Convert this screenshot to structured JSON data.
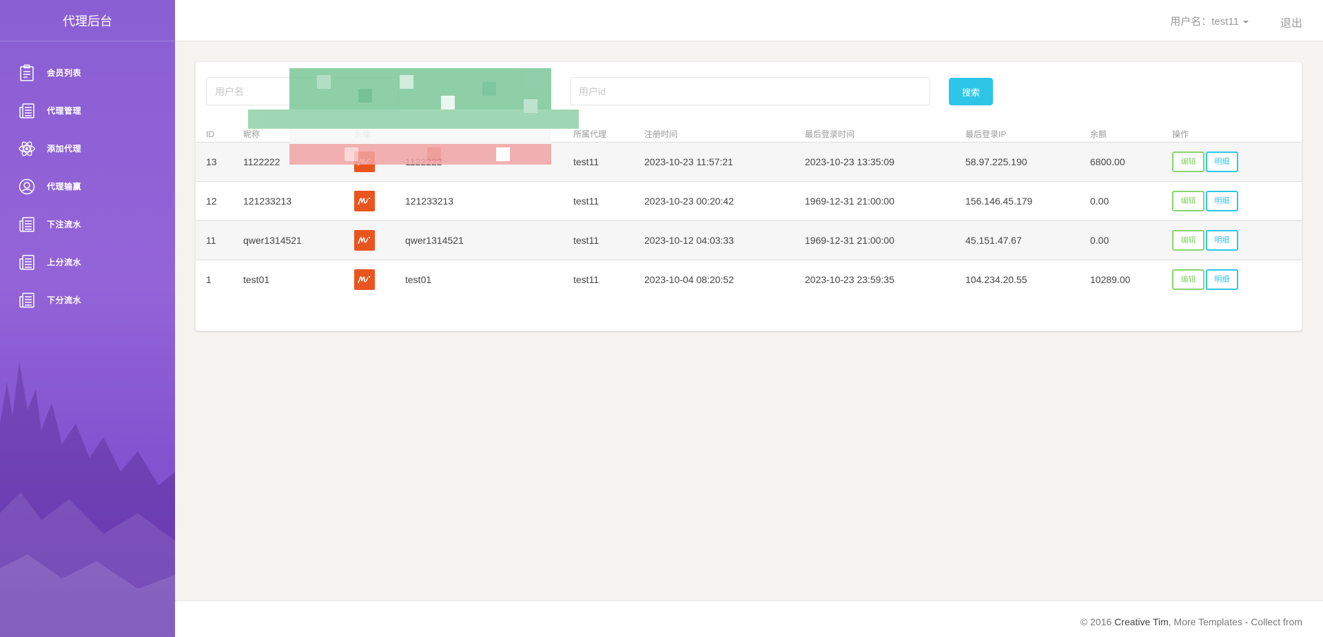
{
  "sidebar": {
    "title": "代理后台",
    "items": [
      {
        "label": "会员列表",
        "icon": "clipboard-icon"
      },
      {
        "label": "代理管理",
        "icon": "news-icon"
      },
      {
        "label": "添加代理",
        "icon": "atom-icon"
      },
      {
        "label": "代理输赢",
        "icon": "user-circle-icon"
      },
      {
        "label": "下注流水",
        "icon": "news-icon"
      },
      {
        "label": "上分流水",
        "icon": "news-icon"
      },
      {
        "label": "下分流水",
        "icon": "news-icon"
      }
    ]
  },
  "topbar": {
    "user_label": "用户名：test11",
    "logout_label": "退出"
  },
  "search": {
    "username_placeholder": "用户名",
    "userid_placeholder": "用户id",
    "button_label": "搜索"
  },
  "table": {
    "headers": [
      "ID",
      "昵称",
      "头像",
      "",
      "所属代理",
      "注册时间",
      "最后登录时间",
      "最后登录IP",
      "余额",
      "操作"
    ],
    "rows": [
      {
        "id": "13",
        "nickname": "1122222",
        "username": "1122222",
        "agent": "test11",
        "registered": "2023-10-23 11:57:21",
        "last_login": "2023-10-23 13:35:09",
        "last_ip": "58.97.225.190",
        "balance": "6800.00"
      },
      {
        "id": "12",
        "nickname": "121233213",
        "username": "121233213",
        "agent": "test11",
        "registered": "2023-10-23 00:20:42",
        "last_login": "1969-12-31 21:00:00",
        "last_ip": "156.146.45.179",
        "balance": "0.00"
      },
      {
        "id": "11",
        "nickname": "qwer1314521",
        "username": "qwer1314521",
        "agent": "test11",
        "registered": "2023-10-12 04:03:33",
        "last_login": "1969-12-31 21:00:00",
        "last_ip": "45.151.47.67",
        "balance": "0.00"
      },
      {
        "id": "1",
        "nickname": "test01",
        "username": "test01",
        "agent": "test11",
        "registered": "2023-10-04 08:20:52",
        "last_login": "2023-10-23 23:59:35",
        "last_ip": "104.234.20.55",
        "balance": "10289.00"
      }
    ],
    "edit_label": "编辑",
    "detail_label": "明细"
  },
  "footer": {
    "copy_prefix": "© 2016 ",
    "copy_brand": "Creative Tim",
    "copy_suffix": ", More Templates - Collect from"
  },
  "colors": {
    "sidebar_top": "#8a5fd4",
    "sidebar_bottom": "#7642c6",
    "accent_cyan": "#2ec6e8",
    "accent_green": "#8bd36c",
    "avatar_orange": "#e9541f"
  }
}
